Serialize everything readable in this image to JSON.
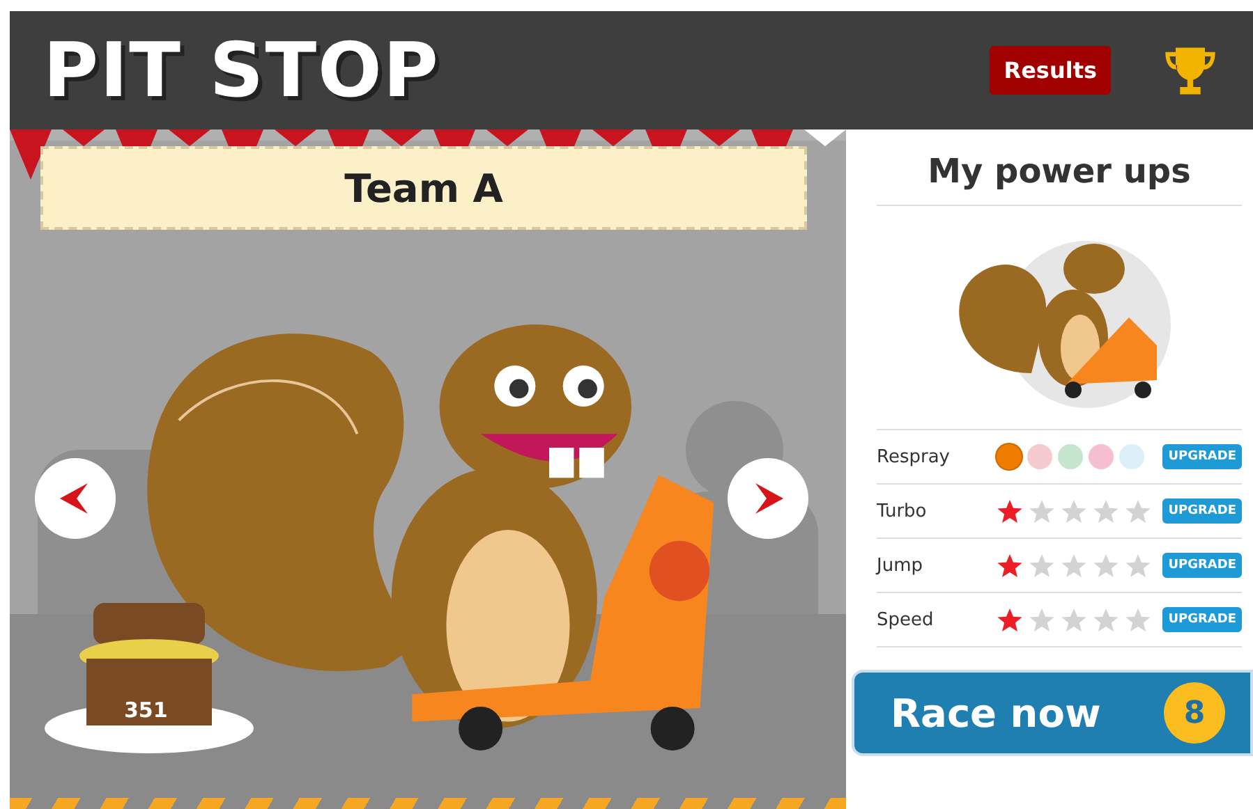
{
  "header": {
    "title": "PIT STOP",
    "results_button": "Results"
  },
  "scene": {
    "team_name": "Team A",
    "coins": "351"
  },
  "power_ups": {
    "title": "My power ups",
    "rows": [
      {
        "kind": "swatches",
        "label": "Respray",
        "swatches": [
          {
            "color": "#ef7d00",
            "selected": true
          },
          {
            "color": "#f6c9cf",
            "selected": false
          },
          {
            "color": "#c3e6cc",
            "selected": false
          },
          {
            "color": "#f7bdd0",
            "selected": false
          },
          {
            "color": "#dceff8",
            "selected": false
          }
        ],
        "button": "UPGRADE"
      },
      {
        "kind": "stars",
        "label": "Turbo",
        "stars": 1,
        "button": "UPGRADE"
      },
      {
        "kind": "stars",
        "label": "Jump",
        "stars": 1,
        "button": "UPGRADE"
      },
      {
        "kind": "stars",
        "label": "Speed",
        "stars": 1,
        "button": "UPGRADE"
      }
    ]
  },
  "race_button": {
    "label": "Race now",
    "count": "8"
  }
}
